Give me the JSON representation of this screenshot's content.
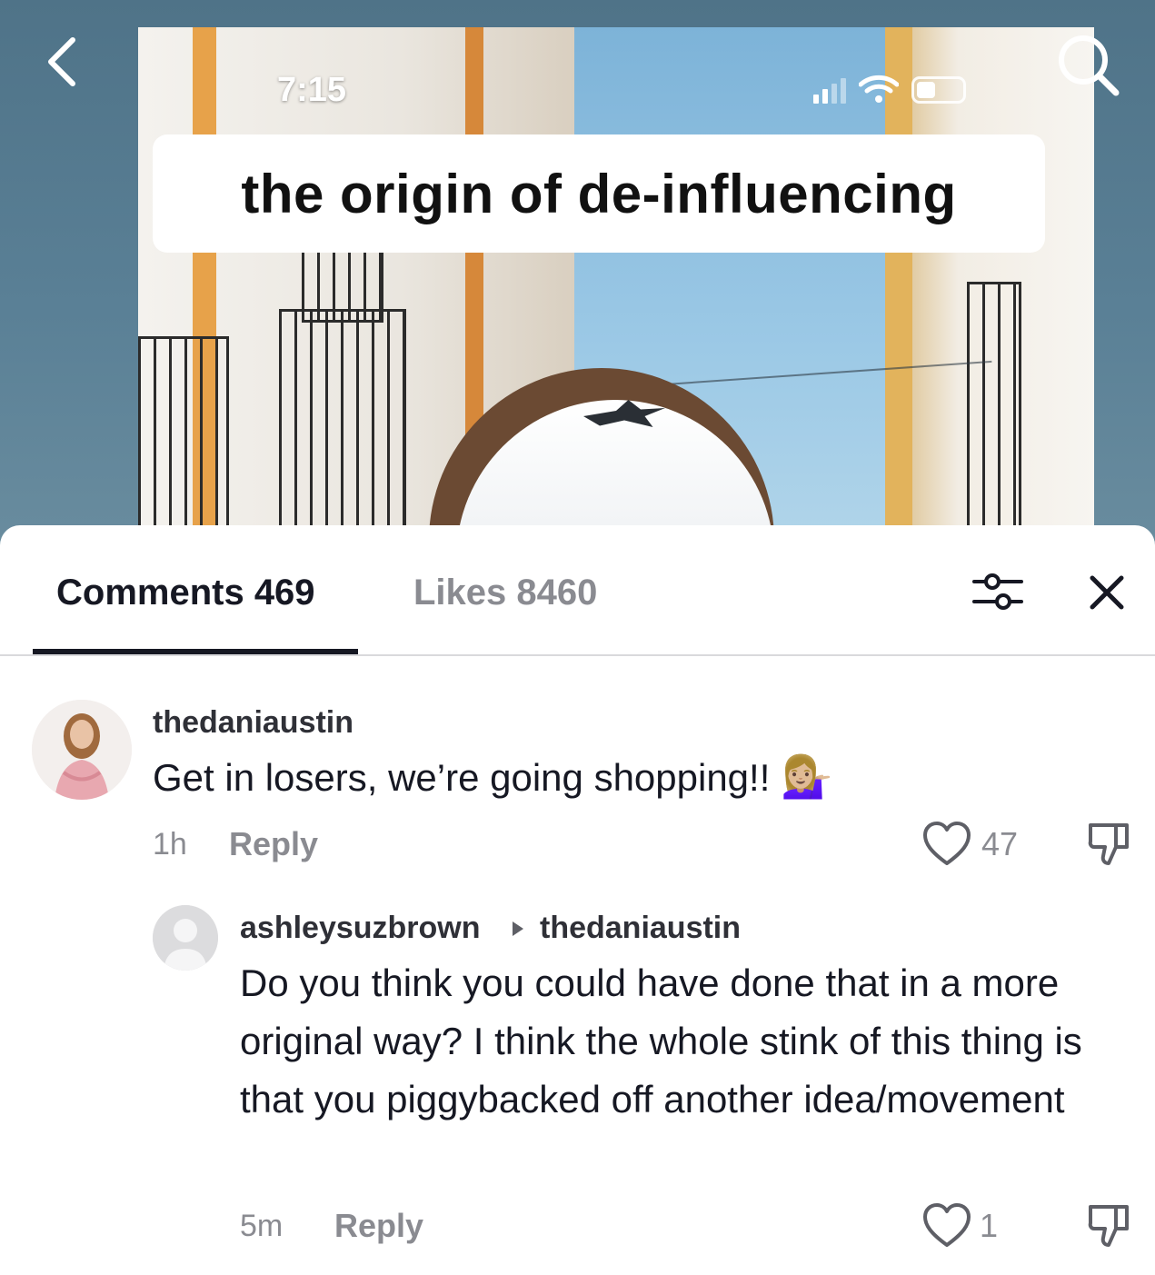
{
  "video": {
    "status_time": "7:15",
    "caption": "the origin of de-influencing"
  },
  "sheet": {
    "tabs": [
      {
        "label": "Comments 469"
      },
      {
        "label": "Likes 8460"
      }
    ]
  },
  "comments": [
    {
      "username": "thedaniaustin",
      "text": "Get in losers, we’re going shopping!!",
      "emoji": "💁🏼‍♀️",
      "time": "1h",
      "reply_label": "Reply",
      "likes": "47"
    },
    {
      "username": "ashleysuzbrown",
      "reply_to": "thedaniaustin",
      "text": "Do you think you could have done that in a more original way? I think the whole stink of this thing is that you piggybacked off another idea/movement",
      "time": "5m",
      "reply_label": "Reply",
      "likes": "1"
    }
  ],
  "colors": {
    "primary_text": "#161823",
    "secondary_text": "#8a8b91",
    "divider": "#d9d9dc"
  }
}
